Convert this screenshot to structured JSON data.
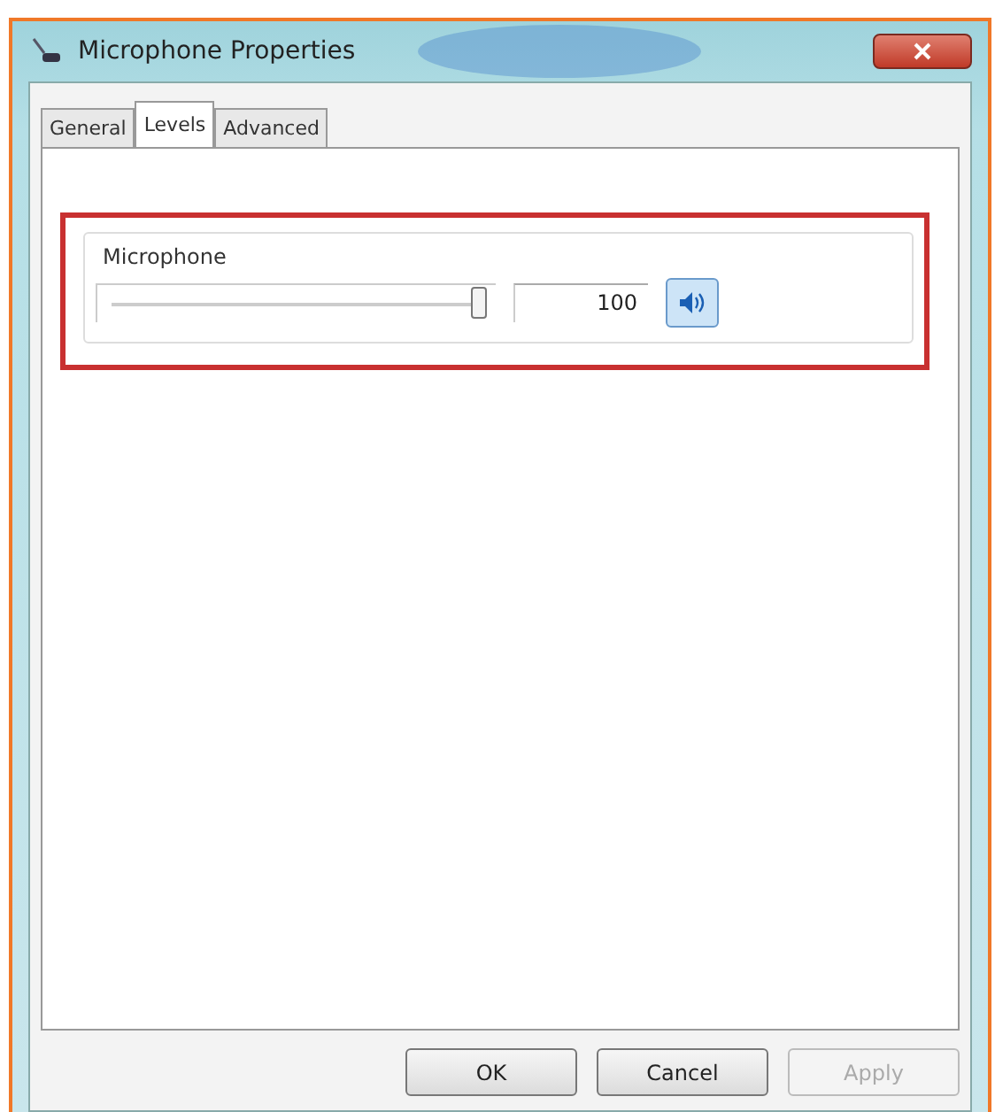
{
  "window": {
    "title": "Microphone Properties"
  },
  "tabs": [
    {
      "label": "General",
      "selected": false
    },
    {
      "label": "Levels",
      "selected": true
    },
    {
      "label": "Advanced",
      "selected": false
    }
  ],
  "group": {
    "title": "Microphone",
    "level": 1,
    "value": "100",
    "muted": false
  },
  "buttons": [
    {
      "label": "OK",
      "disabled": false
    },
    {
      "label": "Cancel",
      "disabled": false
    },
    {
      "label": "Apply",
      "disabled": true
    }
  ]
}
